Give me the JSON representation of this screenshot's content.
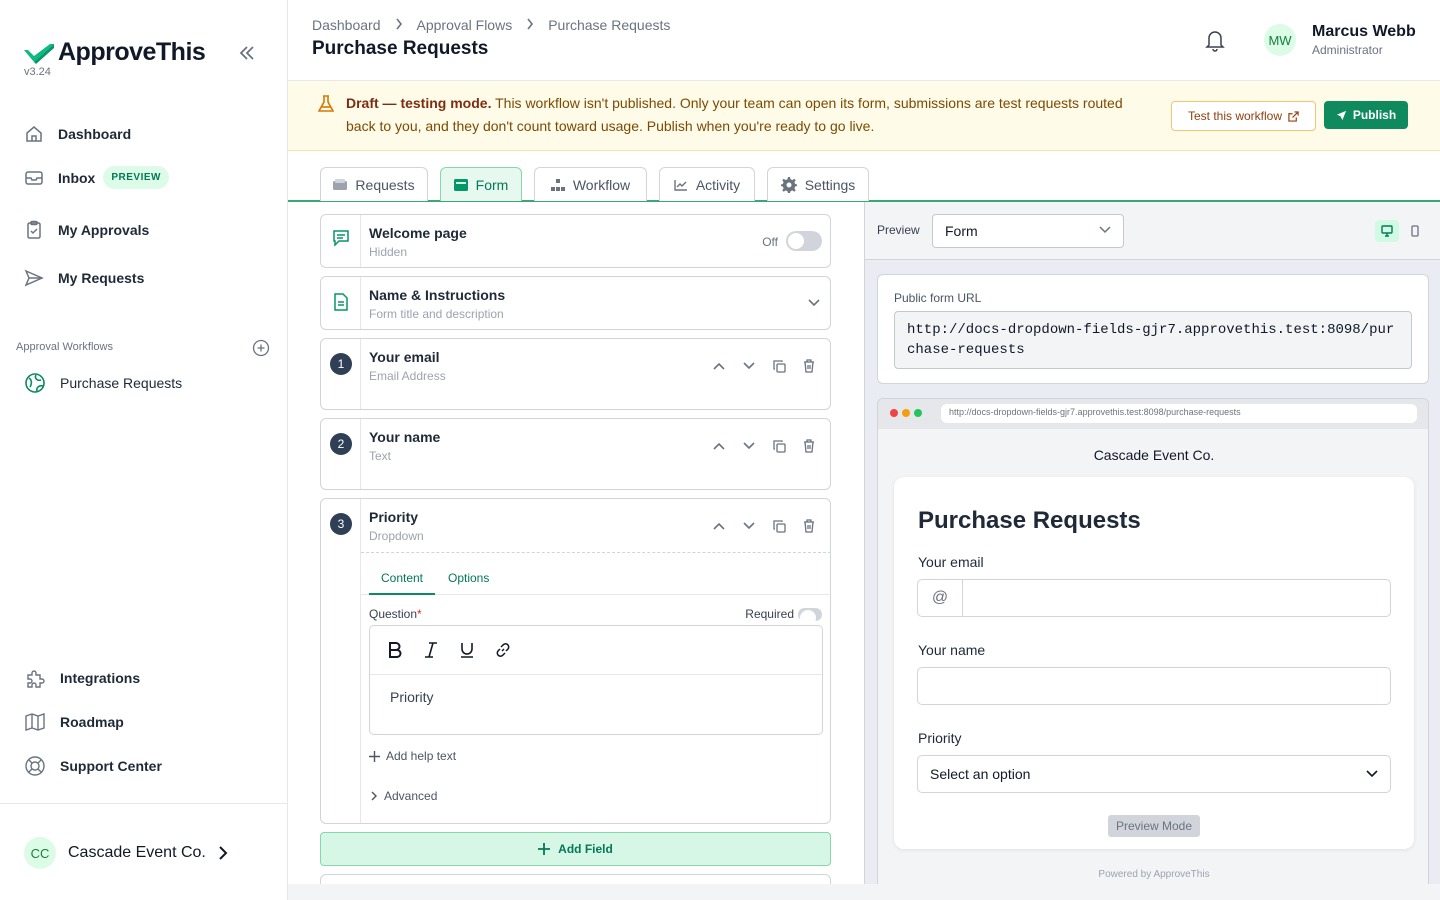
{
  "app": {
    "name": "ApproveThis",
    "version": "v3.24"
  },
  "sidebar": {
    "items": [
      {
        "label": "Dashboard",
        "icon": "home-icon"
      },
      {
        "label": "Inbox",
        "icon": "inbox-icon",
        "badge": "PREVIEW"
      },
      {
        "label": "My Approvals",
        "icon": "clipboard-check-icon"
      },
      {
        "label": "My Requests",
        "icon": "send-icon"
      }
    ],
    "section_label": "Approval Workflows",
    "workflows": [
      {
        "label": "Purchase Requests",
        "icon": "globe-icon"
      }
    ],
    "bottom_items": [
      {
        "label": "Integrations",
        "icon": "puzzle-icon"
      },
      {
        "label": "Roadmap",
        "icon": "map-icon"
      },
      {
        "label": "Support Center",
        "icon": "lifebuoy-icon"
      }
    ],
    "org": {
      "initials": "CC",
      "name": "Cascade Event Co."
    }
  },
  "header": {
    "breadcrumb": [
      "Dashboard",
      "Approval Flows",
      "Purchase Requests"
    ],
    "title": "Purchase Requests",
    "user": {
      "initials": "MW",
      "name": "Marcus Webb",
      "role": "Administrator"
    }
  },
  "banner": {
    "strong": "Draft — testing mode.",
    "text": " This workflow isn't published. Only your team can open its form, submissions are test requests routed back to you, and they don't count toward usage. Publish when you're ready to go live.",
    "test_button": "Test this workflow",
    "publish_button": "Publish"
  },
  "tabs": [
    {
      "label": "Requests",
      "icon": "inbox-tray-icon"
    },
    {
      "label": "Form",
      "icon": "form-icon",
      "active": true
    },
    {
      "label": "Workflow",
      "icon": "workflow-icon"
    },
    {
      "label": "Activity",
      "icon": "chart-line-icon"
    },
    {
      "label": "Settings",
      "icon": "gear-icon"
    }
  ],
  "editor": {
    "welcome": {
      "title": "Welcome page",
      "subtitle": "Hidden",
      "toggle_label": "Off"
    },
    "name_instructions": {
      "title": "Name & Instructions",
      "subtitle": "Form title and description"
    },
    "fields": [
      {
        "num": "1",
        "title": "Your email",
        "type": "Email Address"
      },
      {
        "num": "2",
        "title": "Your name",
        "type": "Text"
      },
      {
        "num": "3",
        "title": "Priority",
        "type": "Dropdown"
      }
    ],
    "field_tabs": [
      "Content",
      "Options"
    ],
    "question_label": "Question",
    "required_star": "*",
    "required_label": "Required",
    "question_value": "Priority",
    "add_help": "Add help text",
    "advanced": "Advanced",
    "add_field": "Add Field"
  },
  "preview": {
    "label": "Preview",
    "mode_selected": "Form",
    "url_label": "Public form URL",
    "url": "http://docs-dropdown-fields-gjr7.approvethis.test:8098/purchase-requests",
    "company": "Cascade Event Co.",
    "form_title": "Purchase Requests",
    "fields": [
      {
        "label": "Your email",
        "prefix": "@"
      },
      {
        "label": "Your name"
      },
      {
        "label": "Priority",
        "placeholder": "Select an option"
      }
    ],
    "preview_mode_button": "Preview Mode",
    "powered_by": "Powered by ApproveThis"
  },
  "colors": {
    "brand": "#0f8a5f",
    "accent_light": "#dcfce7",
    "banner_bg": "#fefbe8",
    "dark_badge": "#2f3f55"
  }
}
